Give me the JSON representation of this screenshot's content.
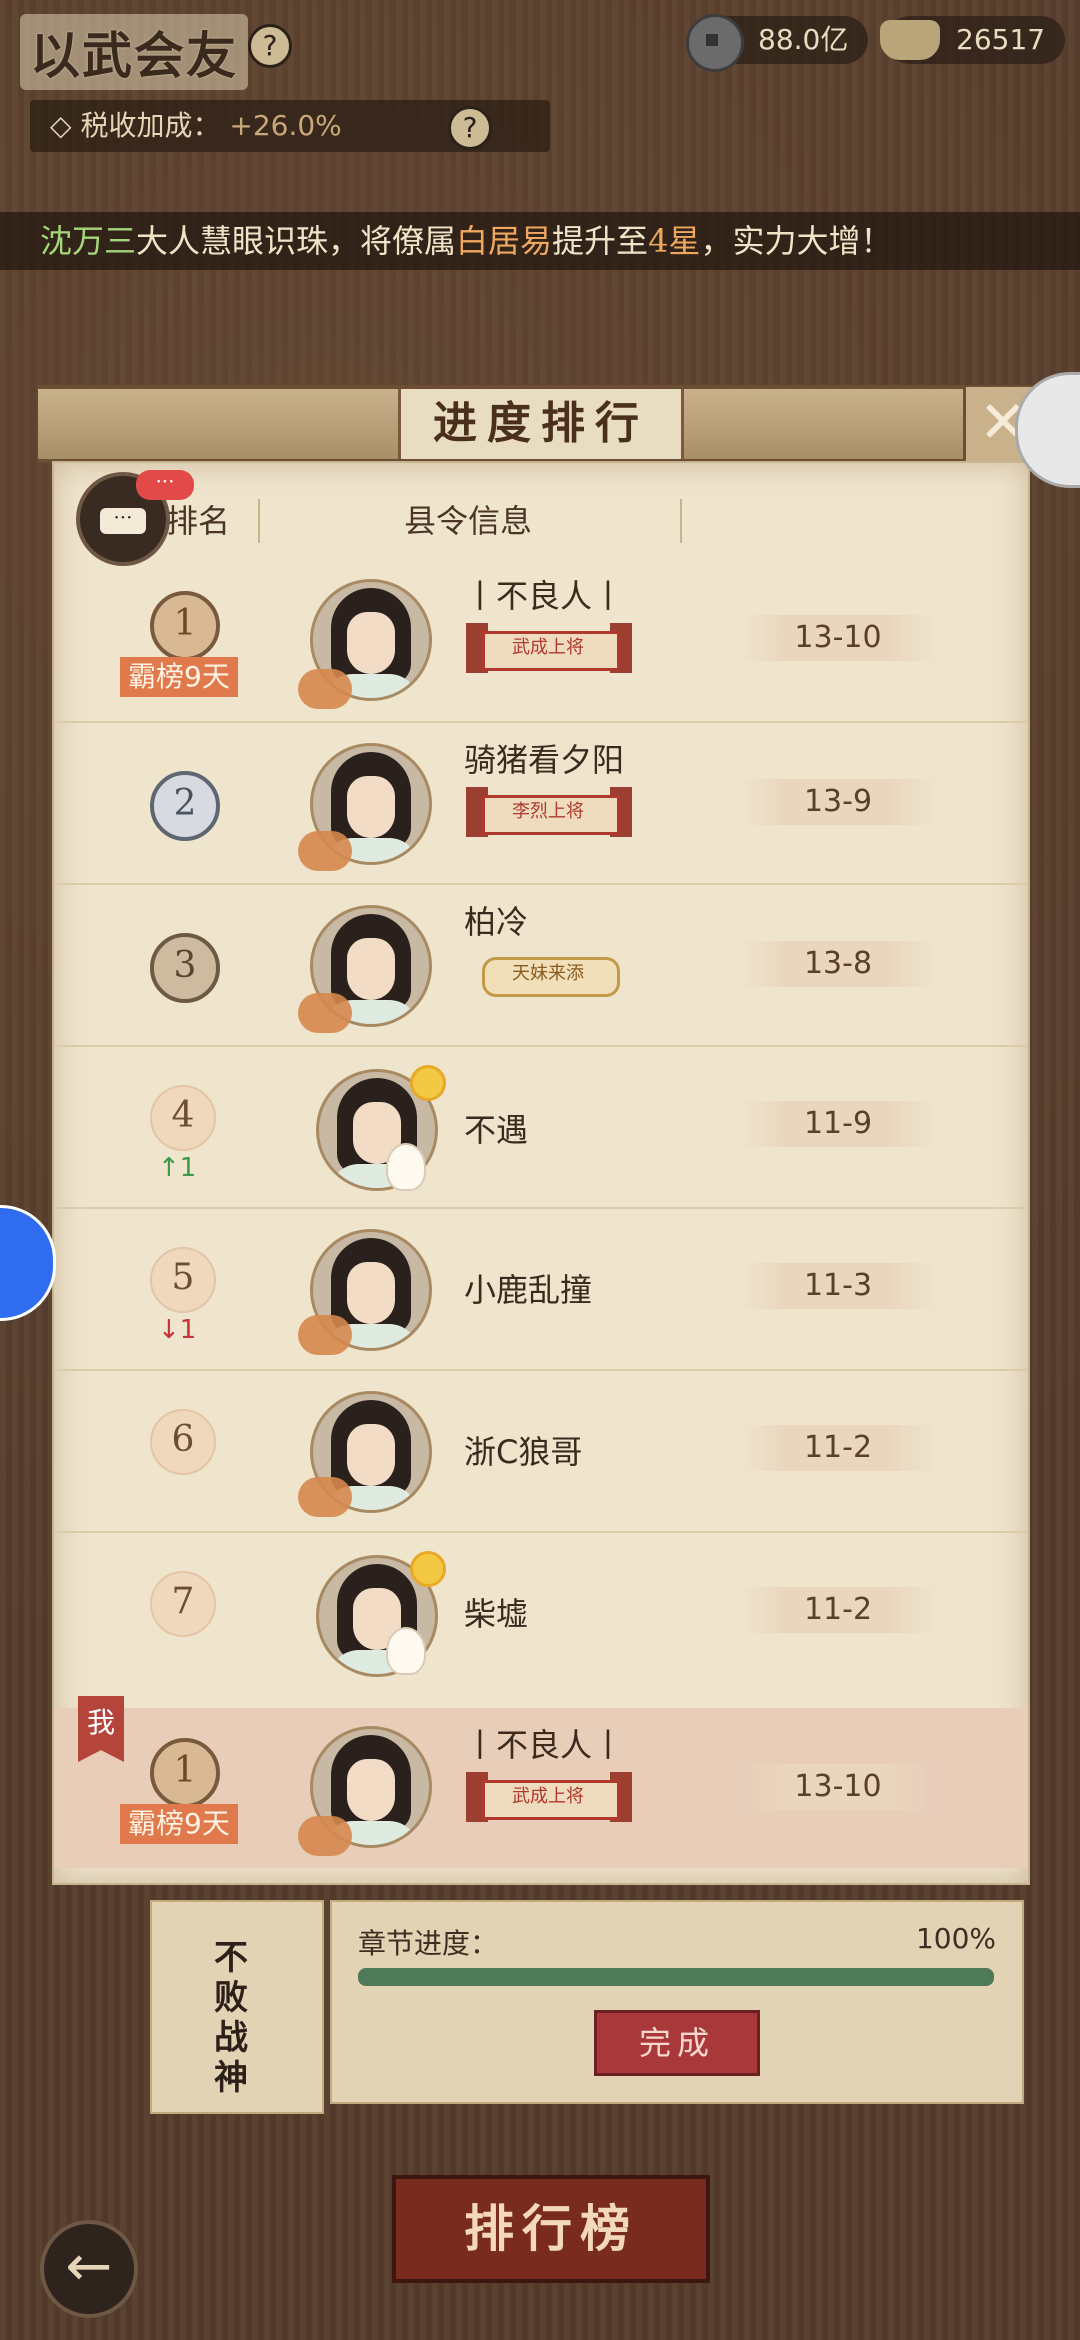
{
  "header": {
    "title": "以武会友",
    "help_icon": "?",
    "silver_amount": "88.0亿",
    "ingot_amount": "26517"
  },
  "tax": {
    "label": "税收加成：",
    "value": "+26.0%",
    "help_icon": "?"
  },
  "broadcast": {
    "name": "沈万三",
    "text1": "大人慧眼识珠，将僚属",
    "subject": "白居易",
    "text2": "提升至",
    "stars": "4星",
    "text3": "，实力大增！"
  },
  "modal": {
    "title": "进度排行",
    "close_icon": "✕",
    "col_rank": "排名",
    "col_info": "县令信息",
    "chat_dots": "···",
    "rows": [
      {
        "rank": "1",
        "name": "丨不良人丨",
        "title": "武成上将",
        "score": "13-10",
        "badge": "霸榜9天",
        "change": ""
      },
      {
        "rank": "2",
        "name": "骑猪看夕阳",
        "title": "李烈上将",
        "score": "13-9",
        "badge": "",
        "change": ""
      },
      {
        "rank": "3",
        "name": "柏冷",
        "title": "天妹来添",
        "score": "13-8",
        "badge": "",
        "change": ""
      },
      {
        "rank": "4",
        "name": "不遇",
        "title": "",
        "score": "11-9",
        "badge": "",
        "change": "↑1"
      },
      {
        "rank": "5",
        "name": "小鹿乱撞",
        "title": "",
        "score": "11-3",
        "badge": "",
        "change": "↓1"
      },
      {
        "rank": "6",
        "name": "浙C狼哥",
        "title": "",
        "score": "11-2",
        "badge": "",
        "change": ""
      },
      {
        "rank": "7",
        "name": "柴墟",
        "title": "",
        "score": "11-2",
        "badge": "",
        "change": ""
      }
    ],
    "me": {
      "tag": "我",
      "rank": "1",
      "name": "丨不良人丨",
      "title": "武成上将",
      "score": "13-10",
      "badge": "霸榜9天"
    }
  },
  "chapter": {
    "label": "章节进度：",
    "percent": "100%",
    "progress": 1.0,
    "done_label": "完成"
  },
  "side_banner": "不败战神",
  "bottom": {
    "rank_button": "排行榜",
    "back_icon": "←"
  }
}
